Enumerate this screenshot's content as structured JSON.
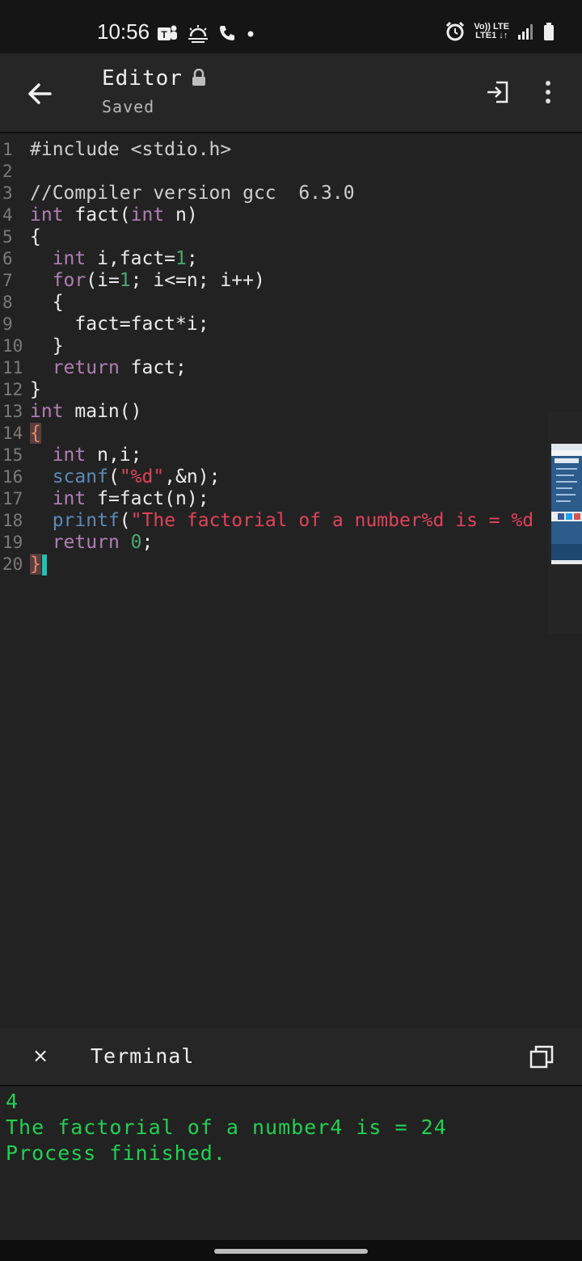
{
  "status_bar": {
    "time": "10:56",
    "network_top": "Vo)) LTE",
    "network_bottom": "LTE1 ↓↑",
    "icons": [
      "teams-icon",
      "weather-icon",
      "phone-call-icon",
      "dot-icon",
      "alarm-icon",
      "signal-icon",
      "battery-icon"
    ]
  },
  "app_bar": {
    "title": "Editor",
    "subtitle": "Saved",
    "icons": [
      "back-arrow-icon",
      "lock-icon",
      "enter-icon",
      "more-vertical-icon"
    ]
  },
  "editor": {
    "lines": [
      {
        "n": "1"
      },
      {
        "n": "2"
      },
      {
        "n": "3"
      },
      {
        "n": "4"
      },
      {
        "n": "5"
      },
      {
        "n": "6"
      },
      {
        "n": "7"
      },
      {
        "n": "8"
      },
      {
        "n": "9"
      },
      {
        "n": "10"
      },
      {
        "n": "11"
      },
      {
        "n": "12"
      },
      {
        "n": "13"
      },
      {
        "n": "14"
      },
      {
        "n": "15"
      },
      {
        "n": "16"
      },
      {
        "n": "17"
      },
      {
        "n": "18"
      },
      {
        "n": "19"
      },
      {
        "n": "20"
      }
    ],
    "tokens": {
      "l1": "#include <stdio.h>",
      "l3": "//Compiler version gcc  6.3.0",
      "l4_kw1": "int",
      "l4_a": " fact(",
      "l4_kw2": "int",
      "l4_b": " n)",
      "l5": "{",
      "l6_ind": "  ",
      "l6_kw": "int",
      "l6_a": " i,fact=",
      "l6_num": "1",
      "l6_b": ";",
      "l7_ind": "  ",
      "l7_kw": "for",
      "l7_a": "(i=",
      "l7_num": "1",
      "l7_b": "; i<=n; i++)",
      "l8": "  {",
      "l9": "    fact=fact*i;",
      "l10": "  }",
      "l11_ind": "  ",
      "l11_kw": "return",
      "l11_a": " fact;",
      "l12": "}",
      "l13_kw": "int",
      "l13_a": " main()",
      "l14": "{",
      "l15_ind": "  ",
      "l15_kw": "int",
      "l15_a": " n,i;",
      "l16_ind": "  ",
      "l16_fn": "scanf",
      "l16_a": "(",
      "l16_str": "\"%d\"",
      "l16_b": ",&n);",
      "l17_ind": "  ",
      "l17_kw": "int",
      "l17_a": " f=fact(n);",
      "l18_ind": "  ",
      "l18_fn": "printf",
      "l18_a": "(",
      "l18_str": "\"The factorial of a number%d is = %d",
      "l19_ind": "  ",
      "l19_kw": "return",
      "l19_a": " ",
      "l19_num": "0",
      "l19_b": ";",
      "l20": "}"
    },
    "accent_colors": {
      "keyword": "#b07fb4",
      "function": "#5c89b8",
      "number": "#4aa86b",
      "string": "#e0435a",
      "cursor": "#1fc2b3"
    }
  },
  "terminal": {
    "close_label": "×",
    "title": "Terminal",
    "output": [
      "4",
      "The factorial of a number4 is = 24",
      "Process finished."
    ],
    "output_color": "#22d052"
  }
}
